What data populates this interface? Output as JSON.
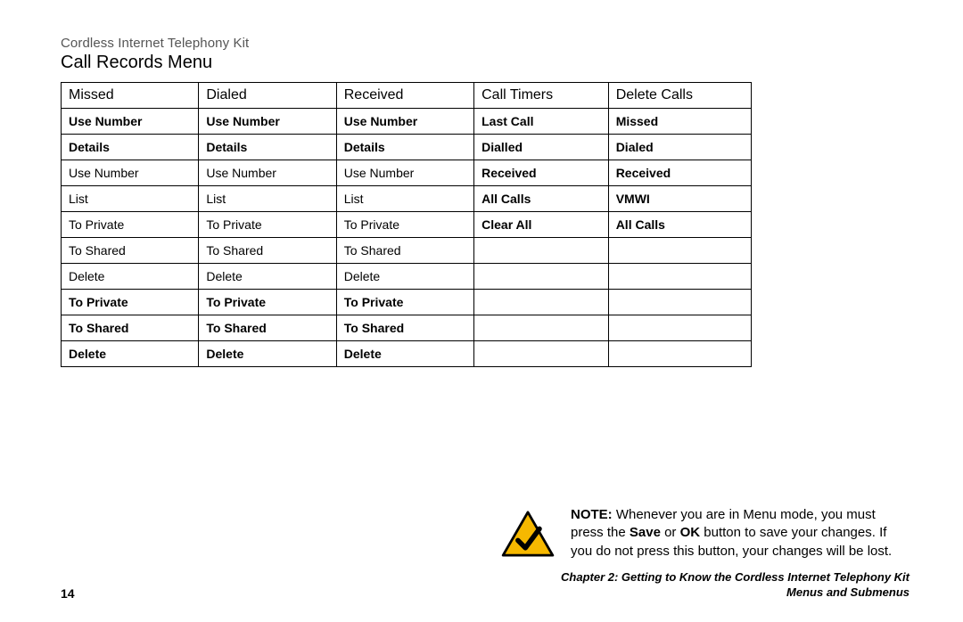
{
  "header": {
    "product_line": "Cordless Internet Telephony Kit",
    "page_title": "Call Records Menu"
  },
  "table": {
    "columns": [
      "Missed",
      "Dialed",
      "Received",
      "Call Timers",
      "Delete Calls"
    ],
    "rows": [
      [
        {
          "t": "Use Number",
          "b": true
        },
        {
          "t": "Use Number",
          "b": true
        },
        {
          "t": "Use Number",
          "b": true
        },
        {
          "t": "Last Call",
          "b": true
        },
        {
          "t": "Missed",
          "b": true
        }
      ],
      [
        {
          "t": "Details",
          "b": true
        },
        {
          "t": "Details",
          "b": true
        },
        {
          "t": "Details",
          "b": true
        },
        {
          "t": "Dialled",
          "b": true
        },
        {
          "t": "Dialed",
          "b": true
        }
      ],
      [
        {
          "t": "Use Number",
          "b": false
        },
        {
          "t": "Use Number",
          "b": false
        },
        {
          "t": "Use Number",
          "b": false
        },
        {
          "t": "Received",
          "b": true
        },
        {
          "t": "Received",
          "b": true
        }
      ],
      [
        {
          "t": "List",
          "b": false
        },
        {
          "t": "List",
          "b": false
        },
        {
          "t": "List",
          "b": false
        },
        {
          "t": "All Calls",
          "b": true
        },
        {
          "t": "VMWI",
          "b": true
        }
      ],
      [
        {
          "t": "To Private",
          "b": false
        },
        {
          "t": "To Private",
          "b": false
        },
        {
          "t": "To Private",
          "b": false
        },
        {
          "t": "Clear All",
          "b": true
        },
        {
          "t": "All Calls",
          "b": true
        }
      ],
      [
        {
          "t": "To Shared",
          "b": false
        },
        {
          "t": "To Shared",
          "b": false
        },
        {
          "t": "To Shared",
          "b": false
        },
        {
          "t": "",
          "b": false
        },
        {
          "t": "",
          "b": false
        }
      ],
      [
        {
          "t": "Delete",
          "b": false
        },
        {
          "t": "Delete",
          "b": false
        },
        {
          "t": "Delete",
          "b": false
        },
        {
          "t": "",
          "b": false
        },
        {
          "t": "",
          "b": false
        }
      ],
      [
        {
          "t": "To Private",
          "b": true
        },
        {
          "t": "To Private",
          "b": true
        },
        {
          "t": "To Private",
          "b": true
        },
        {
          "t": "",
          "b": false
        },
        {
          "t": "",
          "b": false
        }
      ],
      [
        {
          "t": "To Shared",
          "b": true
        },
        {
          "t": "To Shared",
          "b": true
        },
        {
          "t": "To Shared",
          "b": true
        },
        {
          "t": "",
          "b": false
        },
        {
          "t": "",
          "b": false
        }
      ],
      [
        {
          "t": "Delete",
          "b": true
        },
        {
          "t": "Delete",
          "b": true
        },
        {
          "t": "Delete",
          "b": true
        },
        {
          "t": "",
          "b": false
        },
        {
          "t": "",
          "b": false
        }
      ]
    ]
  },
  "note": {
    "label": "NOTE:",
    "body_pre": " Whenever you are in Menu mode, you must press the ",
    "save": "Save",
    "or": " or ",
    "ok": "OK",
    "body_post": " button to save your changes. If you do not press this button, your changes will be lost."
  },
  "footer": {
    "page_number": "14",
    "chapter_line": "Chapter 2: Getting to Know the Cordless Internet Telephony Kit",
    "sub_line": "Menus and Submenus"
  }
}
